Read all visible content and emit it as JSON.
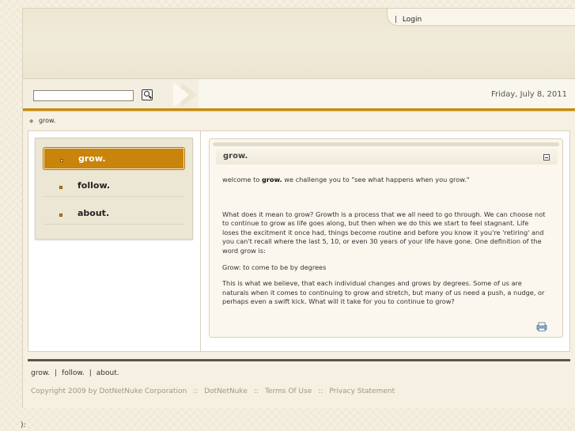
{
  "header": {
    "login_sep": "|",
    "login_label": "Login"
  },
  "search": {
    "value": "",
    "placeholder": ""
  },
  "date": "Friday, July 8, 2011",
  "breadcrumb": {
    "label": "grow."
  },
  "menu": {
    "items": [
      {
        "label": "grow.",
        "active": true
      },
      {
        "label": "follow."
      },
      {
        "label": "about."
      }
    ]
  },
  "module": {
    "title": "grow.",
    "welcome_pre": "welcome to ",
    "welcome_bold": "grow.",
    "welcome_post": "  we challenge you to \"see what happens when you grow.\"",
    "para1": "What does it mean to grow?  Growth is a process that we all need to go through.  We can choose not to continue to grow as life goes along, but then when we do this we start to feel stagnant.  Life loses the excitment it once had, things become routine and before you know it you're 'retiring' and you can't recall where the last 5, 10, or even 30 years of your life have gone.  One definition of the word grow is:",
    "para2": "Grow: to come to be by degrees",
    "para3": "This is what we believe, that each individual changes and grows by degrees.  Some of us are naturals when it comes to continuing to grow and stretch, but many of us need a push, a nudge, or perhaps even a swift kick.  What will it take for you to continue to grow?"
  },
  "footer": {
    "nav": [
      "grow.",
      "follow.",
      "about."
    ],
    "nav_sep": "|",
    "copyright": "Copyright 2009 by DotNetNuke Corporation",
    "link_sep": "::",
    "links": [
      "DotNetNuke",
      "Terms Of Use",
      "Privacy Statement"
    ]
  },
  "stray_text": "):",
  "colors": {
    "accent": "#c9840c",
    "background": "#f4efe1"
  },
  "icons": {
    "search": "search-icon",
    "minimize": "minimize-icon",
    "print": "print-icon",
    "breadcrumb": "diamond-icon"
  }
}
